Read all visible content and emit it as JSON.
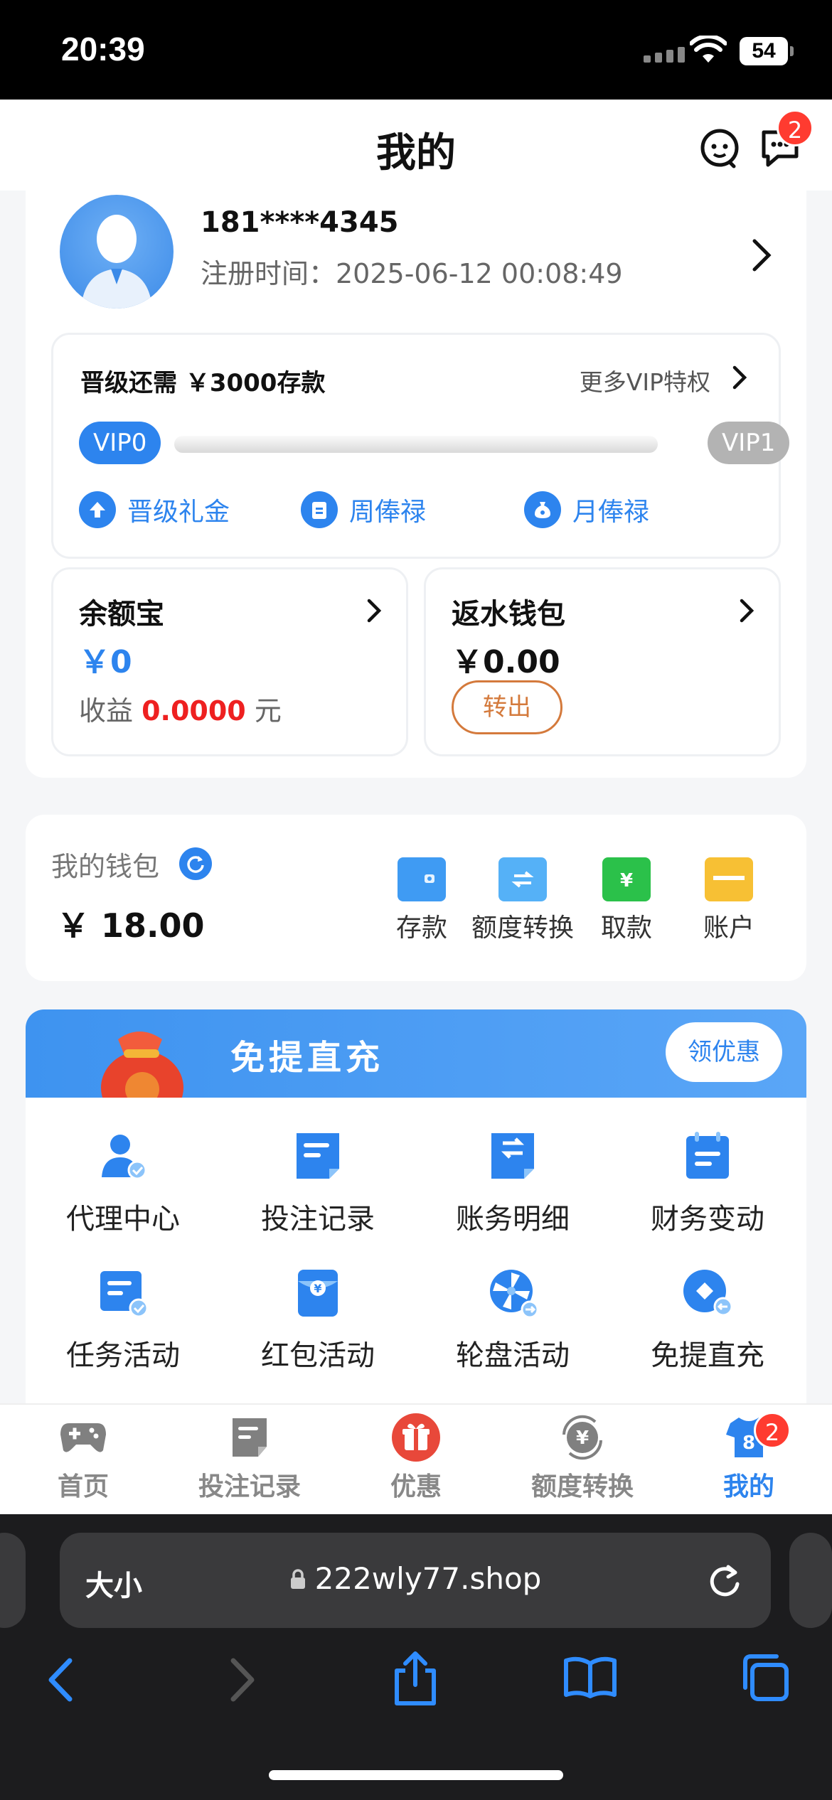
{
  "status": {
    "time": "20:39",
    "battery": "54"
  },
  "header": {
    "title": "我的",
    "message_badge": "2"
  },
  "profile": {
    "username": "181****4345",
    "reg_time": "注册时间：2025-06-12 00:08:49"
  },
  "vip": {
    "need": "晋级还需 ￥3000存款",
    "more": "更多VIP特权",
    "current": "VIP0",
    "next": "VIP1",
    "progress": 0,
    "benefits": [
      "晋级礼金",
      "周俸禄",
      "月俸禄"
    ]
  },
  "yuebao": {
    "title": "余额宝",
    "amount": "￥0",
    "earn_label": "收益",
    "earn_value": "0.0000",
    "earn_unit": "元"
  },
  "rebate": {
    "title": "返水钱包",
    "amount": "￥0.00",
    "button": "转出"
  },
  "wallet": {
    "label": "我的钱包",
    "balance": "￥ 18.00",
    "actions": [
      "存款",
      "额度转换",
      "取款",
      "账户"
    ]
  },
  "promo": {
    "title": "免提直充",
    "button": "领优惠"
  },
  "grid": [
    "代理中心",
    "投注记录",
    "账务明细",
    "财务变动",
    "任务活动",
    "红包活动",
    "轮盘活动",
    "免提直充"
  ],
  "tabs": {
    "items": [
      "首页",
      "投注记录",
      "优惠",
      "额度转换",
      "我的"
    ],
    "active": "我的",
    "badge": "2"
  },
  "browser": {
    "text_size": "大小",
    "url": "222wly77.shop"
  },
  "colors": {
    "accent": "#2d84ee",
    "red": "#ff3b30",
    "orange": "#d47a3c"
  }
}
